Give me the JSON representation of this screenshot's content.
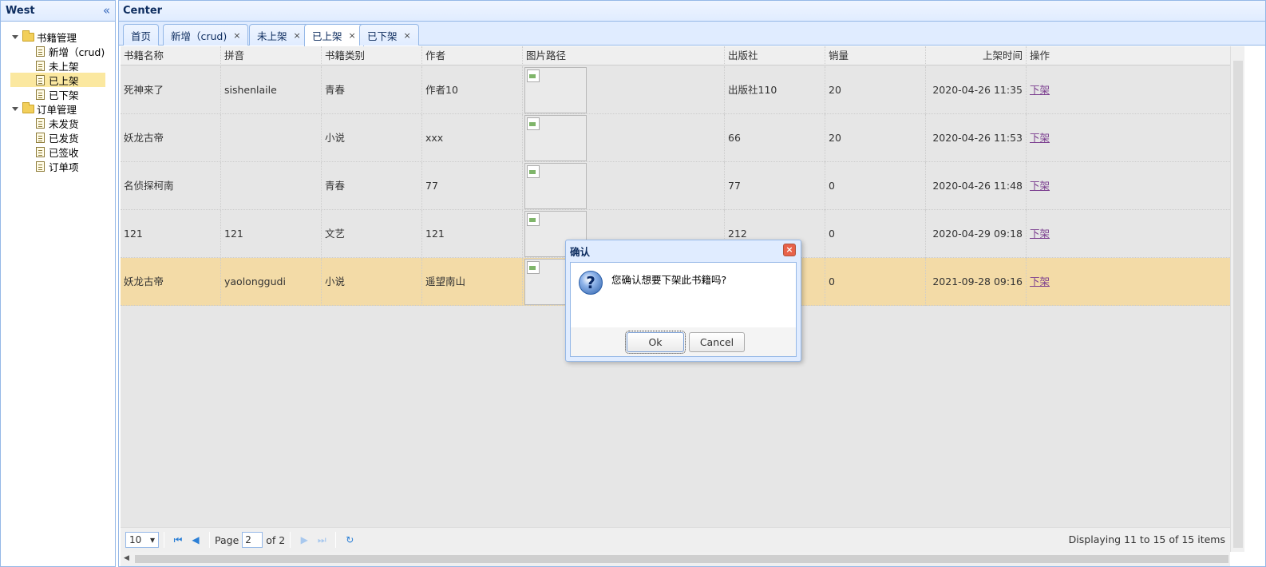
{
  "west": {
    "title": "West",
    "tree": [
      {
        "label": "书籍管理",
        "children": [
          "新增（crud)",
          "未上架",
          "已上架",
          "已下架"
        ]
      },
      {
        "label": "订单管理",
        "children": [
          "未发货",
          "已发货",
          "已签收",
          "订单项"
        ]
      }
    ]
  },
  "center": {
    "title": "Center",
    "tabs": [
      "首页",
      "新增（crud)",
      "未上架",
      "已上架",
      "已下架"
    ],
    "close_glyph": "×"
  },
  "grid": {
    "columns": [
      "书籍名称",
      "拼音",
      "书籍类别",
      "作者",
      "图片路径",
      "出版社",
      "销量",
      "上架时间",
      "操作"
    ],
    "rows": [
      {
        "name": "死神来了",
        "pinyin": "sishenlaile",
        "category": "青春",
        "author": "作者10",
        "publisher": "出版社110",
        "sales": "20",
        "time": "2020-04-26 11:35",
        "action": "下架"
      },
      {
        "name": "妖龙古帝",
        "pinyin": "",
        "category": "小说",
        "author": "xxx",
        "publisher": "66",
        "sales": "20",
        "time": "2020-04-26 11:53",
        "action": "下架"
      },
      {
        "name": "名侦探柯南",
        "pinyin": "",
        "category": "青春",
        "author": "77",
        "publisher": "77",
        "sales": "0",
        "time": "2020-04-26 11:48",
        "action": "下架"
      },
      {
        "name": "121",
        "pinyin": "121",
        "category": "文艺",
        "author": "121",
        "publisher": "212",
        "sales": "0",
        "time": "2020-04-29 09:18",
        "action": "下架"
      },
      {
        "name": "妖龙古帝",
        "pinyin": "yaolonggudi",
        "category": "小说",
        "author": "遥望南山",
        "publisher": "",
        "sales": "0",
        "time": "2021-09-28 09:16",
        "action": "下架"
      }
    ]
  },
  "pager": {
    "page_size": "10",
    "page_label": "Page",
    "page_value": "2",
    "of_label": "of 2",
    "info": "Displaying 11 to 15 of 15 items"
  },
  "dialog": {
    "title": "确认",
    "icon": "?",
    "message": "您确认想要下架此书籍吗?",
    "ok": "Ok",
    "cancel": "Cancel",
    "close_glyph": "×"
  }
}
